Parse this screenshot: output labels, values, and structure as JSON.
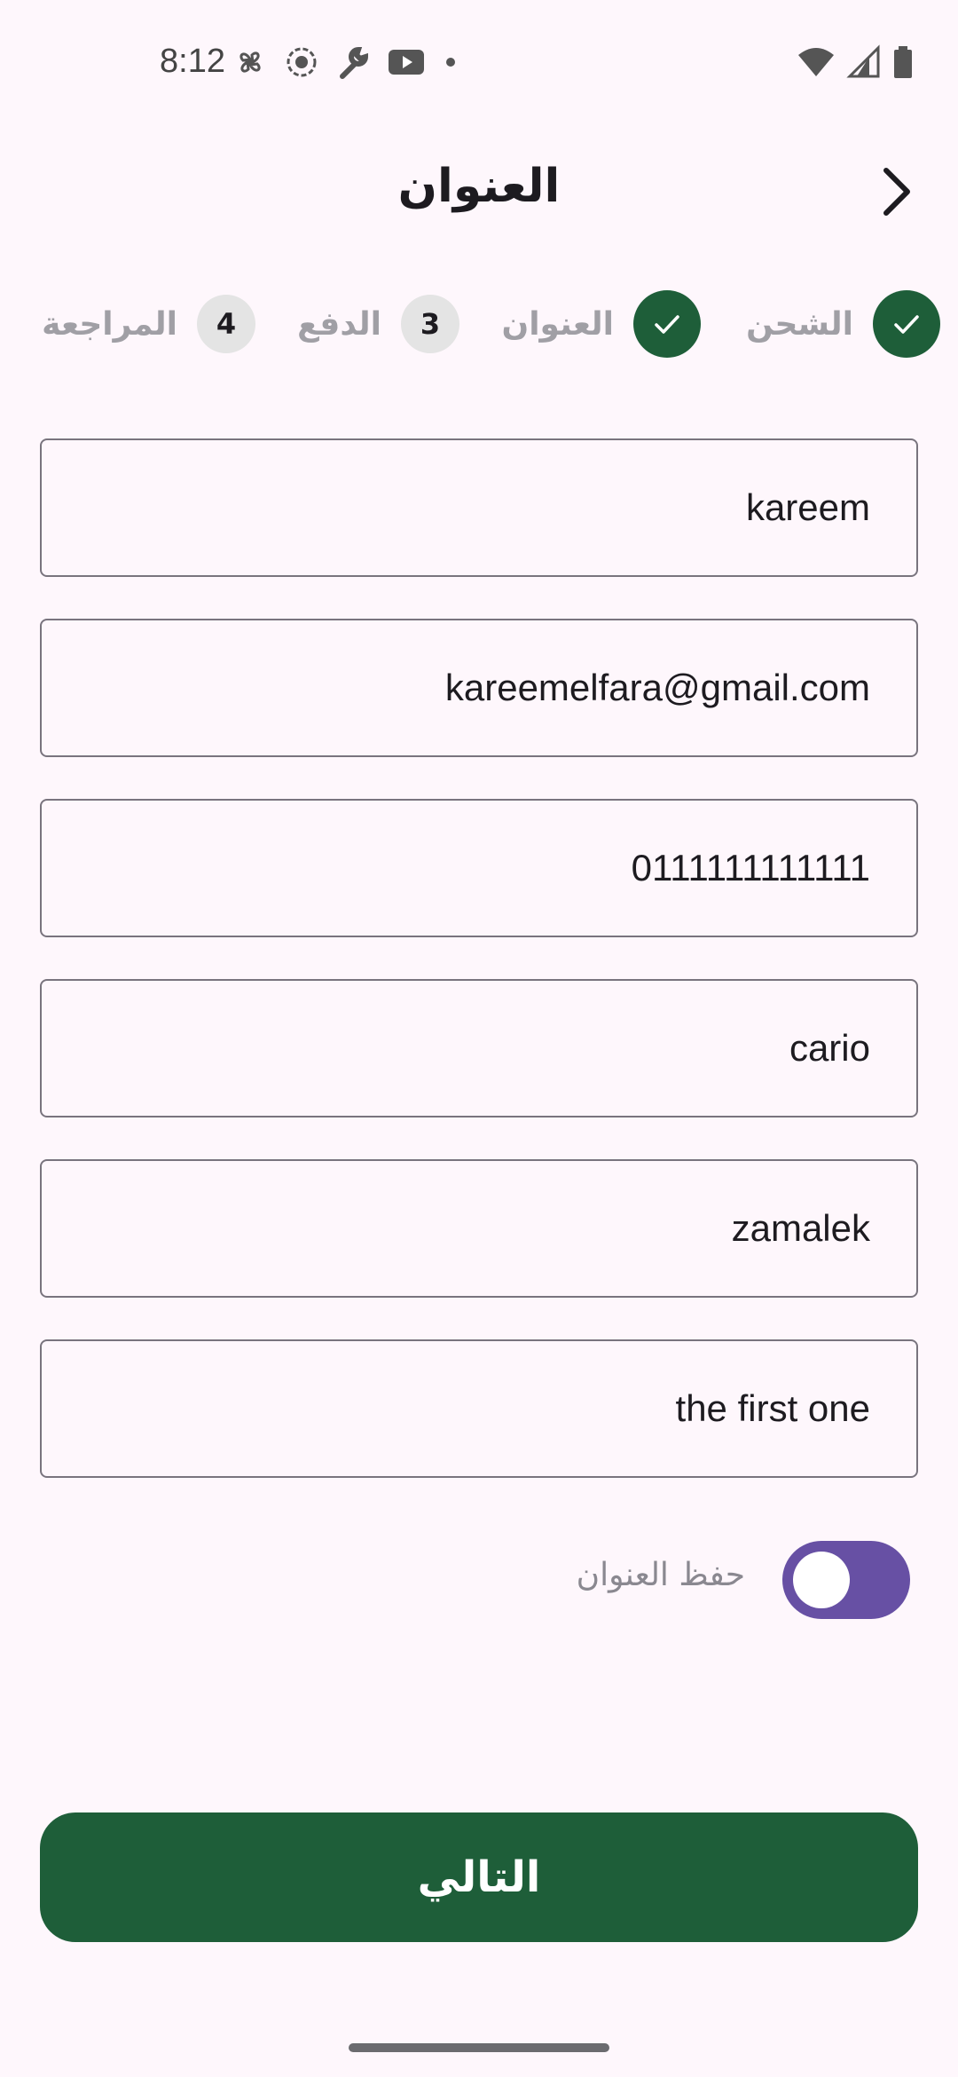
{
  "status_bar": {
    "time": "8:12",
    "left_icons": [
      "fan-icon",
      "record-icon",
      "wrench-icon",
      "youtube-icon",
      "dot-icon"
    ],
    "right_icons": [
      "wifi-icon",
      "cell-signal-icon",
      "battery-icon"
    ]
  },
  "header": {
    "title": "العنوان",
    "back_icon": "chevron-right-icon"
  },
  "stepper": {
    "steps": [
      {
        "label": "الشحن",
        "state": "done"
      },
      {
        "label": "العنوان",
        "state": "done"
      },
      {
        "label": "الدفع",
        "number": "3",
        "state": "todo"
      },
      {
        "label": "المراجعة",
        "number": "4",
        "state": "todo"
      }
    ]
  },
  "form": {
    "fields": [
      {
        "value": "kareem"
      },
      {
        "value": "kareemelfara@gmail.com"
      },
      {
        "value": "0111111111111"
      },
      {
        "value": "cario"
      },
      {
        "value": "zamalek"
      },
      {
        "value": "the first one"
      }
    ]
  },
  "save_address": {
    "label": "حفظ العنوان",
    "enabled": true
  },
  "next_button": {
    "label": "التالي"
  },
  "colors": {
    "primary_green": "#1e5e39",
    "switch_purple": "#6750a4",
    "background": "#fef7fc"
  }
}
